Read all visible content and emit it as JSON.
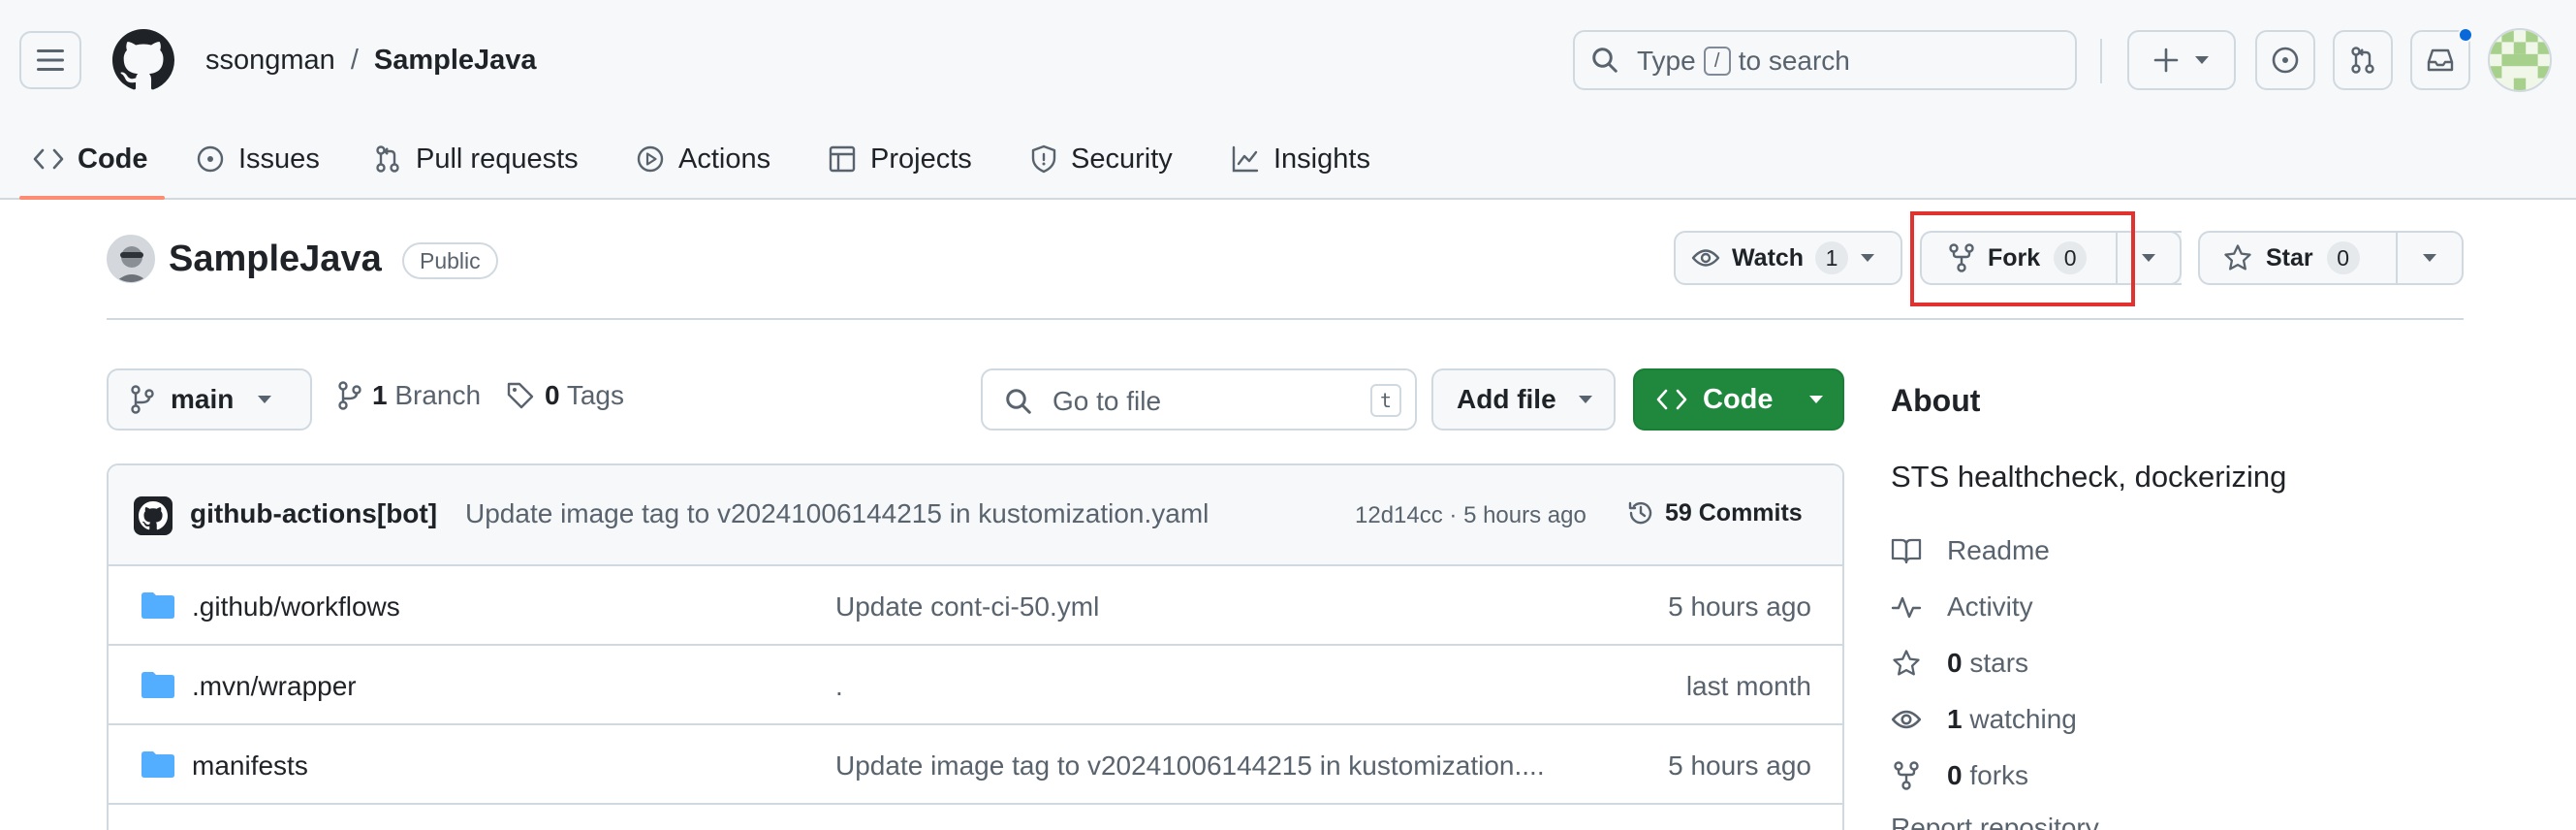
{
  "header": {
    "owner": "ssongman",
    "separator": "/",
    "repo": "SampleJava",
    "search": {
      "before": "Type",
      "key": "/",
      "after": "to search"
    }
  },
  "nav": {
    "tabs": [
      {
        "label": "Code",
        "icon": "code-icon",
        "active": true
      },
      {
        "label": "Issues",
        "icon": "issue-icon"
      },
      {
        "label": "Pull requests",
        "icon": "pull-request-icon"
      },
      {
        "label": "Actions",
        "icon": "play-icon"
      },
      {
        "label": "Projects",
        "icon": "table-icon"
      },
      {
        "label": "Security",
        "icon": "shield-icon"
      },
      {
        "label": "Insights",
        "icon": "graph-icon"
      }
    ]
  },
  "repo": {
    "title": "SampleJava",
    "visibility": "Public",
    "watch": {
      "label": "Watch",
      "count": "1"
    },
    "fork": {
      "label": "Fork",
      "count": "0"
    },
    "star": {
      "label": "Star",
      "count": "0"
    }
  },
  "toolbar": {
    "branch": "main",
    "branches": {
      "count": "1",
      "label": "Branch"
    },
    "tags": {
      "count": "0",
      "label": "Tags"
    },
    "goto_placeholder": "Go to file",
    "goto_key": "t",
    "add_file": "Add file",
    "code": "Code"
  },
  "commit": {
    "author": "github-actions[bot]",
    "message": "Update image tag to v20241006144215 in kustomization.yaml",
    "meta": "12d14cc · 5 hours ago",
    "commits": "59 Commits"
  },
  "files": [
    {
      "name": ".github/workflows",
      "message": "Update cont-ci-50.yml",
      "date": "5 hours ago"
    },
    {
      "name": ".mvn/wrapper",
      "message": ".",
      "date": "last month"
    },
    {
      "name": "manifests",
      "message": "Update image tag to v20241006144215 in kustomization....",
      "date": "5 hours ago"
    }
  ],
  "about": {
    "title": "About",
    "description": "STS healthcheck, dockerizing",
    "readme": "Readme",
    "activity": "Activity",
    "stars": {
      "count": "0",
      "label": "stars"
    },
    "watching": {
      "count": "1",
      "label": "watching"
    },
    "forks": {
      "count": "0",
      "label": "forks"
    },
    "report": "Report repository"
  },
  "colors": {
    "accent_green": "#1f883d",
    "highlight_red": "#e0322f",
    "folder_blue": "#54aeff",
    "tab_underline": "#fd8c73"
  }
}
